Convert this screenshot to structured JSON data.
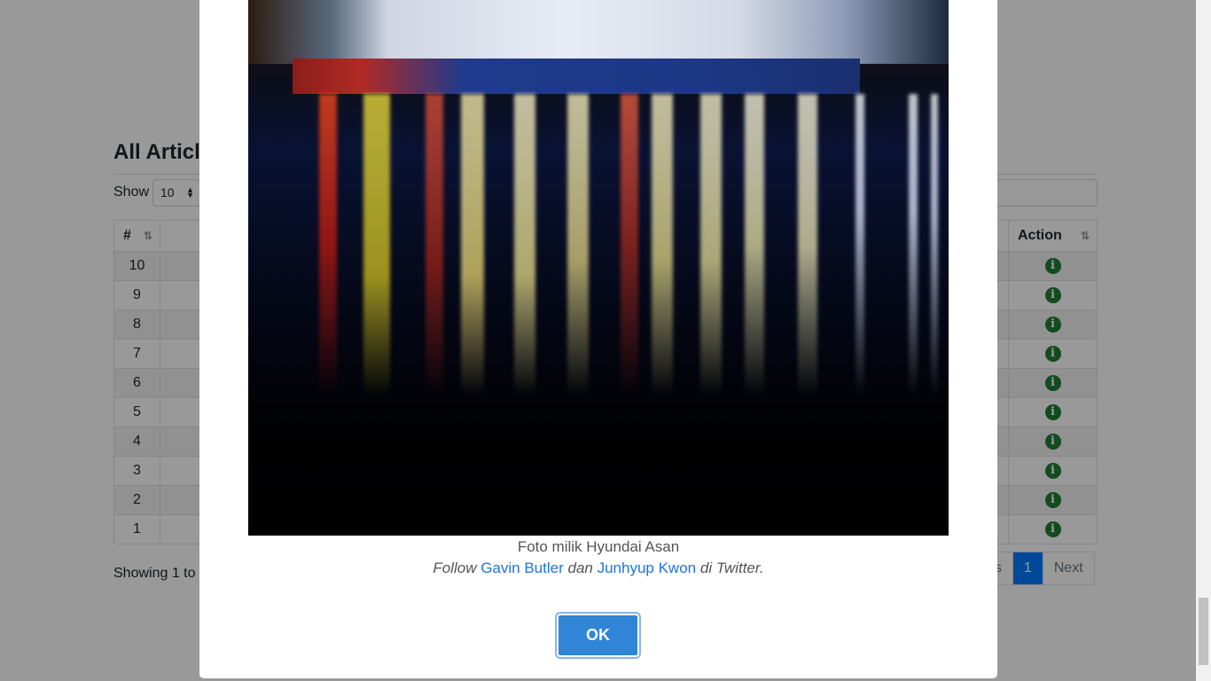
{
  "page": {
    "title": "All Articles",
    "show_label": "Show",
    "length_value": "10",
    "table": {
      "headers": {
        "num": "#",
        "action": "Action"
      },
      "rows": [
        "10",
        "9",
        "8",
        "7",
        "6",
        "5",
        "4",
        "3",
        "2",
        "1"
      ]
    },
    "showing_text": "Showing 1 to",
    "pagination": {
      "previous": "us",
      "current": "1",
      "next": "Next"
    }
  },
  "modal": {
    "photo_credit": "Foto milik Hyundai Asan",
    "follow_prefix": "Follow",
    "author1": "Gavin Butler",
    "connector": "dan",
    "author2": "Junhyup Kwon",
    "suffix": "di Twitter.",
    "ok_label": "OK"
  }
}
